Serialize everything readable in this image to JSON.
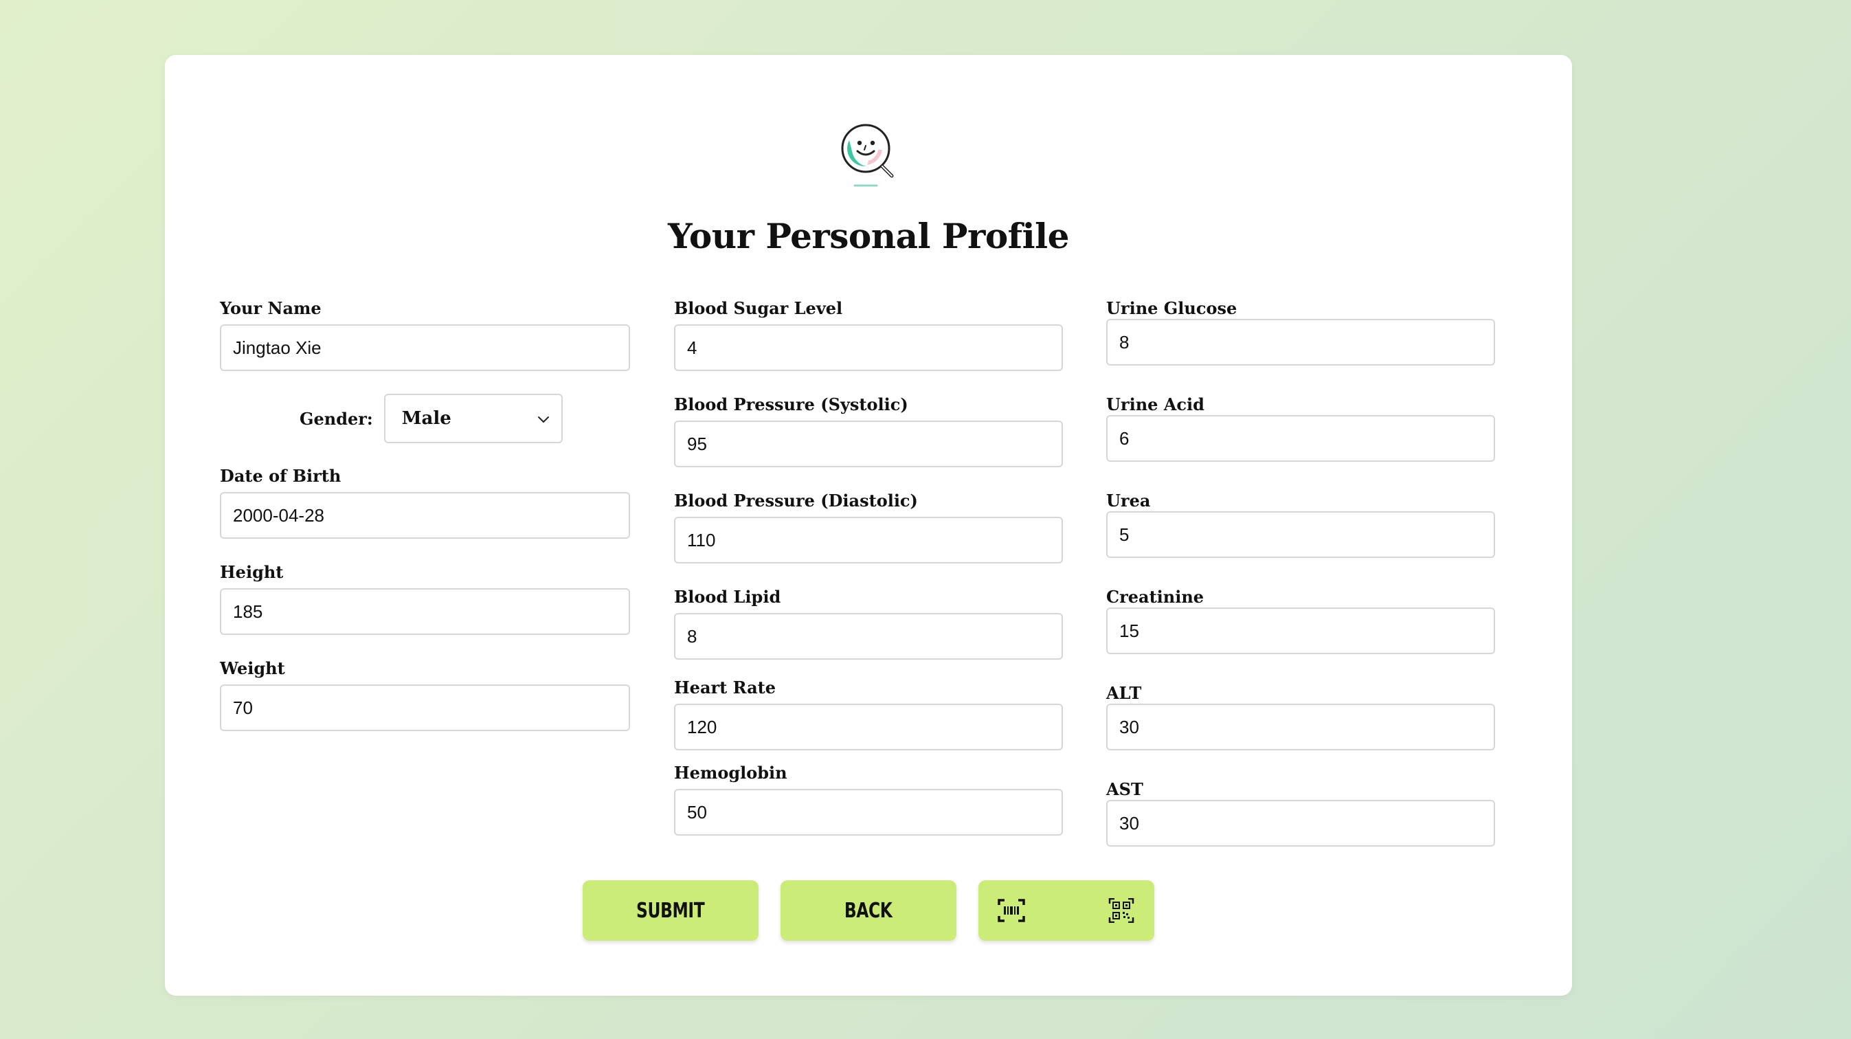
{
  "page": {
    "title": "Your Personal Profile"
  },
  "left": {
    "name": {
      "label": "Your Name",
      "value": "Jingtao Xie"
    },
    "gender": {
      "label": "Gender:",
      "value": "Male"
    },
    "dob": {
      "label": "Date of Birth",
      "value": "2000-04-28"
    },
    "height": {
      "label": "Height",
      "value": "185"
    },
    "weight": {
      "label": "Weight",
      "value": "70"
    }
  },
  "middle": {
    "blood_sugar": {
      "label": "Blood Sugar Level",
      "value": "4"
    },
    "bp_systolic": {
      "label": "Blood Pressure (Systolic)",
      "value": "95"
    },
    "bp_diastolic": {
      "label": "Blood Pressure (Diastolic)",
      "value": "110"
    },
    "blood_lipid": {
      "label": "Blood Lipid",
      "value": "8"
    },
    "heart_rate": {
      "label": "Heart Rate",
      "value": "120"
    },
    "hemoglobin": {
      "label": "Hemoglobin",
      "value": "50"
    }
  },
  "right": {
    "urine_glucose": {
      "label": "Urine Glucose",
      "value": "8"
    },
    "urine_acid": {
      "label": "Urine Acid",
      "value": "6"
    },
    "urea": {
      "label": "Urea",
      "value": "5"
    },
    "creatinine": {
      "label": "Creatinine",
      "value": "15"
    },
    "alt": {
      "label": "ALT",
      "value": "30"
    },
    "ast": {
      "label": "AST",
      "value": "30"
    }
  },
  "buttons": {
    "submit": "Submit",
    "back": "Back",
    "scan_icons": [
      "barcode-scan-icon",
      "qr-code-icon"
    ]
  },
  "colors": {
    "button_bg": "#cbed77",
    "logo_accent": "#3ec7a0"
  }
}
